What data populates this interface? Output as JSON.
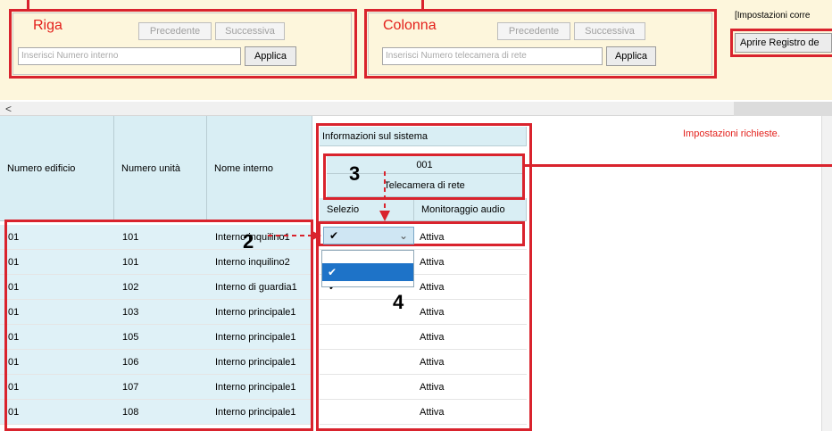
{
  "row_filter": {
    "title": "Riga",
    "prev_label": "Precedente",
    "next_label": "Successiva",
    "input_placeholder": "Inserisci Numero interno",
    "apply_label": "Applica"
  },
  "column_filter": {
    "title": "Colonna",
    "prev_label": "Precedente",
    "next_label": "Successiva",
    "input_placeholder": "Inserisci Numero telecamera di rete",
    "apply_label": "Applica"
  },
  "settings_panel": {
    "heading": "[Impostazioni corre",
    "open_registry_label": "Aprire Registro de"
  },
  "scrollbar": {
    "left_arrow": "<"
  },
  "grid": {
    "col_building": "Numero edificio",
    "col_unit": "Numero unità",
    "col_name": "Nome interno",
    "system_info": "Informazioni sul sistema",
    "camera_number": "001",
    "camera_type": "Telecamera di rete",
    "sub_select": "Selezio",
    "sub_audio": "Monitoraggio audio",
    "required_settings": "Impostazioni richieste.",
    "rows": [
      {
        "building": "01",
        "unit": "101",
        "name": "Interno inquilino1",
        "selected": "✔",
        "audio": "Attiva"
      },
      {
        "building": "01",
        "unit": "101",
        "name": "Interno inquilino2",
        "selected": "",
        "audio": "Attiva"
      },
      {
        "building": "01",
        "unit": "102",
        "name": "Interno di guardia1",
        "selected": "✔",
        "audio": "Attiva"
      },
      {
        "building": "01",
        "unit": "103",
        "name": "Interno principale1",
        "selected": "",
        "audio": "Attiva"
      },
      {
        "building": "01",
        "unit": "105",
        "name": "Interno principale1",
        "selected": "",
        "audio": "Attiva"
      },
      {
        "building": "01",
        "unit": "106",
        "name": "Interno principale1",
        "selected": "",
        "audio": "Attiva"
      },
      {
        "building": "01",
        "unit": "107",
        "name": "Interno principale1",
        "selected": "",
        "audio": "Attiva"
      },
      {
        "building": "01",
        "unit": "108",
        "name": "Interno principale1",
        "selected": "",
        "audio": "Attiva"
      }
    ],
    "dropdown": {
      "value": "✔",
      "option_checked": "✔",
      "chevron": "⌄"
    }
  },
  "callouts": {
    "two": "2",
    "three": "3",
    "four": "4"
  },
  "colors": {
    "accent_red": "#d9232d",
    "header_blue": "#d9eef4",
    "dropdown_selected": "#1e73c8",
    "panel_cream": "#fdf6dc"
  }
}
